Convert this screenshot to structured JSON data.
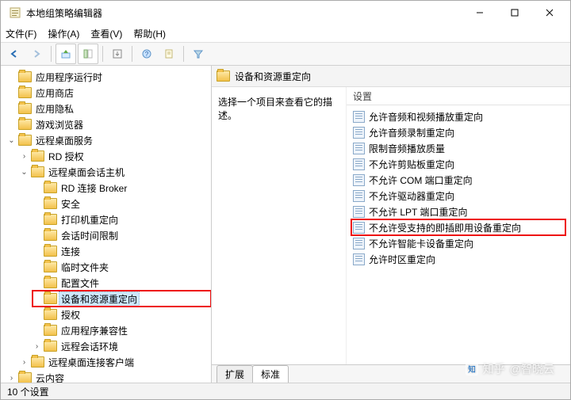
{
  "window": {
    "title": "本地组策略编辑器"
  },
  "menu": {
    "file": "文件(F)",
    "action": "操作(A)",
    "view": "查看(V)",
    "help": "帮助(H)"
  },
  "toolbar": {
    "back": "back",
    "forward": "forward",
    "up": "up",
    "show_hide": "show-hide-tree",
    "export": "export-list",
    "help": "help",
    "properties": "properties",
    "filter": "filter"
  },
  "tree": {
    "items": [
      {
        "label": "应用程序运行时",
        "tw": "none"
      },
      {
        "label": "应用商店",
        "tw": "none"
      },
      {
        "label": "应用隐私",
        "tw": "none"
      },
      {
        "label": "游戏浏览器",
        "tw": "none"
      },
      {
        "label": "远程桌面服务",
        "tw": "open",
        "children": [
          {
            "label": "RD 授权",
            "tw": "closed"
          },
          {
            "label": "远程桌面会话主机",
            "tw": "open",
            "children": [
              {
                "label": "RD 连接 Broker",
                "tw": "none"
              },
              {
                "label": "安全",
                "tw": "none"
              },
              {
                "label": "打印机重定向",
                "tw": "none"
              },
              {
                "label": "会话时间限制",
                "tw": "none"
              },
              {
                "label": "连接",
                "tw": "none"
              },
              {
                "label": "临时文件夹",
                "tw": "none"
              },
              {
                "label": "配置文件",
                "tw": "none"
              },
              {
                "label": "设备和资源重定向",
                "tw": "none",
                "selected": true,
                "highlight": true
              },
              {
                "label": "授权",
                "tw": "none"
              },
              {
                "label": "应用程序兼容性",
                "tw": "none"
              },
              {
                "label": "远程会话环境",
                "tw": "closed"
              }
            ]
          },
          {
            "label": "远程桌面连接客户端",
            "tw": "closed"
          }
        ]
      },
      {
        "label": "云内容",
        "tw": "closed"
      }
    ]
  },
  "right": {
    "header": "设备和资源重定向",
    "desc_prompt": "选择一个项目来查看它的描述。",
    "settings_header": "设置",
    "settings": [
      {
        "label": "允许音频和视频播放重定向"
      },
      {
        "label": "允许音频录制重定向"
      },
      {
        "label": "限制音频播放质量"
      },
      {
        "label": "不允许剪贴板重定向"
      },
      {
        "label": "不允许 COM 端口重定向"
      },
      {
        "label": "不允许驱动器重定向"
      },
      {
        "label": "不允许 LPT 端口重定向"
      },
      {
        "label": "不允许受支持的即插即用设备重定向",
        "highlight": true
      },
      {
        "label": "不允许智能卡设备重定向"
      },
      {
        "label": "允许时区重定向"
      }
    ],
    "tabs": {
      "extended": "扩展",
      "standard": "标准"
    }
  },
  "status": {
    "text": "10 个设置"
  },
  "watermark": {
    "site": "知乎",
    "author": "@智晓云"
  }
}
